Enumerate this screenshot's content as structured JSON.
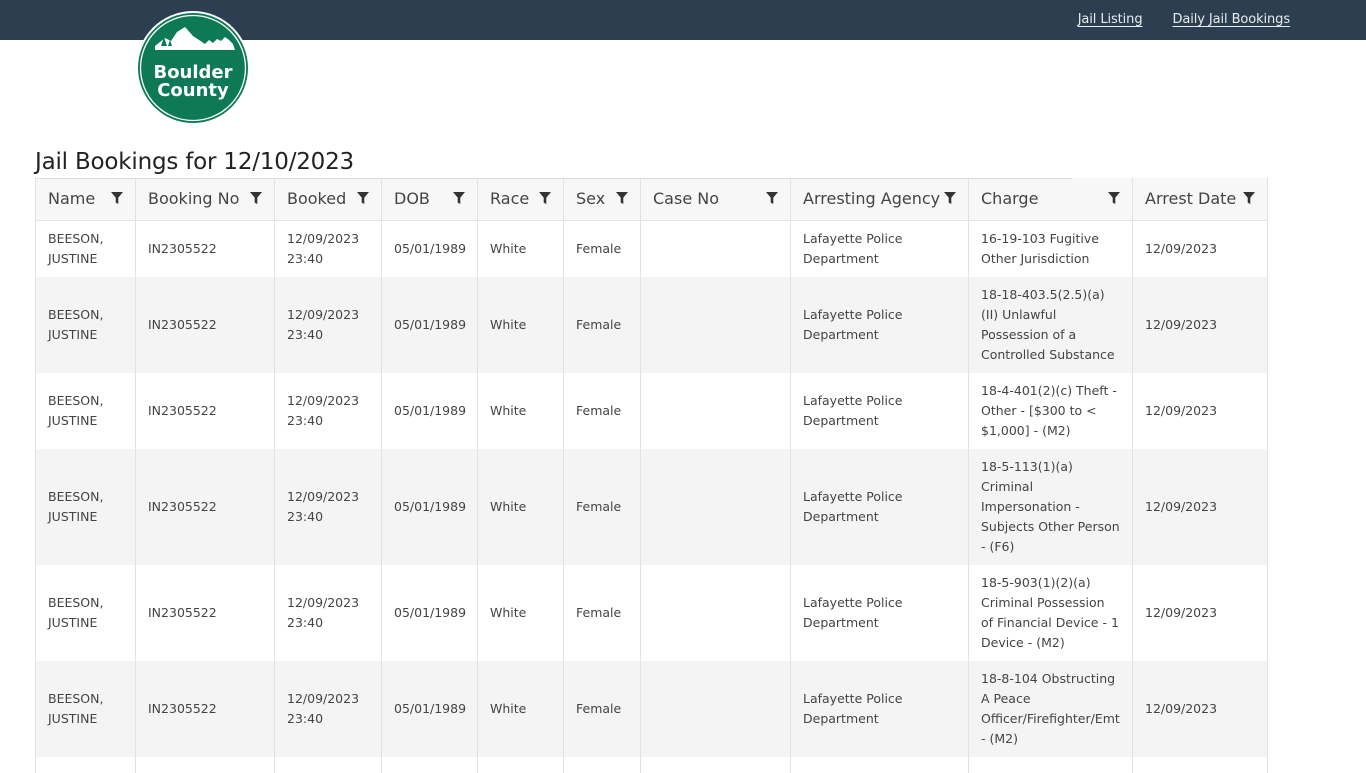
{
  "nav": {
    "links": [
      "Jail Listing",
      "Daily Jail Bookings"
    ]
  },
  "logo": {
    "line1": "Boulder",
    "line2": "County",
    "brand_color": "#0e7a55"
  },
  "page": {
    "title": "Jail Bookings for 12/10/2023"
  },
  "table": {
    "columns": [
      "Name",
      "Booking No",
      "Booked",
      "DOB",
      "Race",
      "Sex",
      "Case No",
      "Arresting Agency",
      "Charge",
      "Arrest Date"
    ],
    "rows": [
      {
        "name": "BEESON, JUSTINE",
        "booking_no": "IN2305522",
        "booked": "12/09/2023 23:40",
        "dob": "05/01/1989",
        "race": "White",
        "sex": "Female",
        "case_no": "",
        "agency": "Lafayette Police Department",
        "charge": "16-19-103 Fugitive Other Jurisdiction",
        "arrest_date": "12/09/2023"
      },
      {
        "name": "BEESON, JUSTINE",
        "booking_no": "IN2305522",
        "booked": "12/09/2023 23:40",
        "dob": "05/01/1989",
        "race": "White",
        "sex": "Female",
        "case_no": "",
        "agency": "Lafayette Police Department",
        "charge": "18-18-403.5(2.5)(a)(II) Unlawful Possession of a Controlled Substance",
        "arrest_date": "12/09/2023"
      },
      {
        "name": "BEESON, JUSTINE",
        "booking_no": "IN2305522",
        "booked": "12/09/2023 23:40",
        "dob": "05/01/1989",
        "race": "White",
        "sex": "Female",
        "case_no": "",
        "agency": "Lafayette Police Department",
        "charge": "18-4-401(2)(c) Theft - Other - [$300 to < $1,000] - (M2)",
        "arrest_date": "12/09/2023"
      },
      {
        "name": "BEESON, JUSTINE",
        "booking_no": "IN2305522",
        "booked": "12/09/2023 23:40",
        "dob": "05/01/1989",
        "race": "White",
        "sex": "Female",
        "case_no": "",
        "agency": "Lafayette Police Department",
        "charge": "18-5-113(1)(a) Criminal Impersonation - Subjects Other Person - (F6)",
        "arrest_date": "12/09/2023"
      },
      {
        "name": "BEESON, JUSTINE",
        "booking_no": "IN2305522",
        "booked": "12/09/2023 23:40",
        "dob": "05/01/1989",
        "race": "White",
        "sex": "Female",
        "case_no": "",
        "agency": "Lafayette Police Department",
        "charge": "18-5-903(1)(2)(a) Criminal Possession of Financial Device - 1 Device - (M2)",
        "arrest_date": "12/09/2023"
      },
      {
        "name": "BEESON, JUSTINE",
        "booking_no": "IN2305522",
        "booked": "12/09/2023 23:40",
        "dob": "05/01/1989",
        "race": "White",
        "sex": "Female",
        "case_no": "",
        "agency": "Lafayette Police Department",
        "charge": "18-8-104 Obstructing A Peace Officer/Firefighter/Emt - (M2)",
        "arrest_date": "12/09/2023"
      },
      {
        "name": "",
        "booking_no": "",
        "booked": "",
        "dob": "",
        "race": "",
        "sex": "",
        "case_no": "",
        "agency": "",
        "charge": "",
        "arrest_date": ""
      }
    ]
  }
}
